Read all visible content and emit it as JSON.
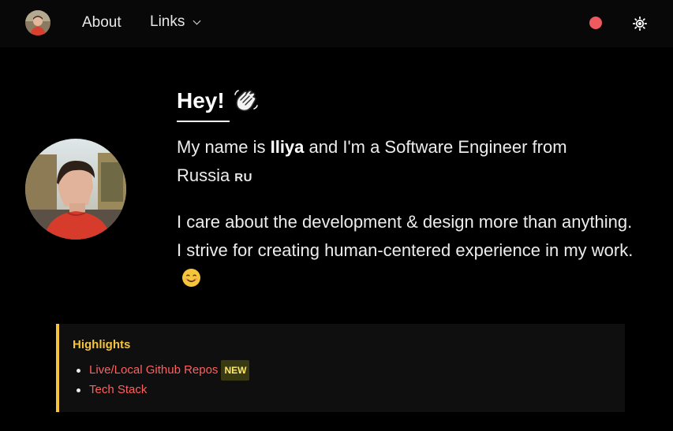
{
  "nav": {
    "about_label": "About",
    "links_label": "Links",
    "status_color": "#ee5a5f"
  },
  "hero": {
    "greeting": "Hey!",
    "intro_prefix": "My name is ",
    "name": "Iliya",
    "intro_suffix": " and I'm a Software Engineer from Russia",
    "flag_text": "RU",
    "paragraph2": "I care about the development & design more than anything. I strive for creating human-centered experience in my work."
  },
  "highlights": {
    "title": "Highlights",
    "items": [
      {
        "label": "Live/Local Github Repos",
        "badge": "NEW"
      },
      {
        "label": "Tech Stack"
      }
    ]
  },
  "colors": {
    "accent_yellow": "#f5c43b",
    "link_red": "#ff5f5f",
    "background": "#000000"
  }
}
